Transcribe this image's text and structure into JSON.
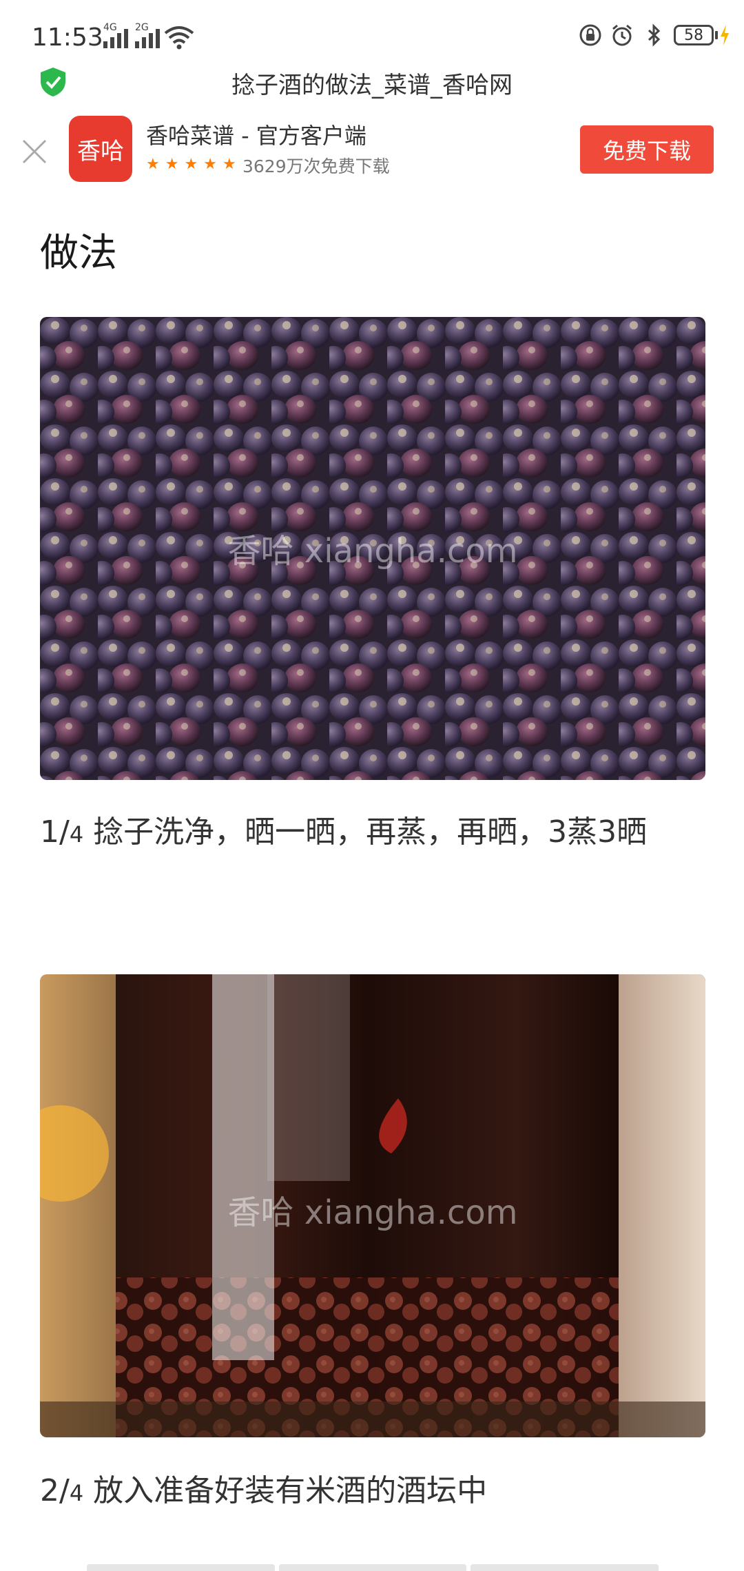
{
  "status_bar": {
    "time": "11:53",
    "signal1_label": "4G",
    "signal2_label": "2G",
    "battery": "58"
  },
  "title_bar": {
    "title": "捻子酒的做法_菜谱_香哈网"
  },
  "banner": {
    "logo_text": "香哈",
    "app_name": "香哈菜谱 - 官方客户端",
    "stars": 5,
    "downloads": "3629万次免费下载",
    "download_label": "免费下载"
  },
  "section_title": "做法",
  "watermark": "香哈 xiangha.com",
  "steps": [
    {
      "num": "1/",
      "total": "4",
      "text": " 捻子洗净，晒一晒，再蒸，再晒，3蒸3晒"
    },
    {
      "num": "2/",
      "total": "4",
      "text": " 放入准备好装有米酒的酒坛中"
    }
  ],
  "colors": {
    "accent": "#f04a3a",
    "logo_bg": "#e63b2e",
    "star": "#ff7d00",
    "shield": "#2db84d"
  }
}
